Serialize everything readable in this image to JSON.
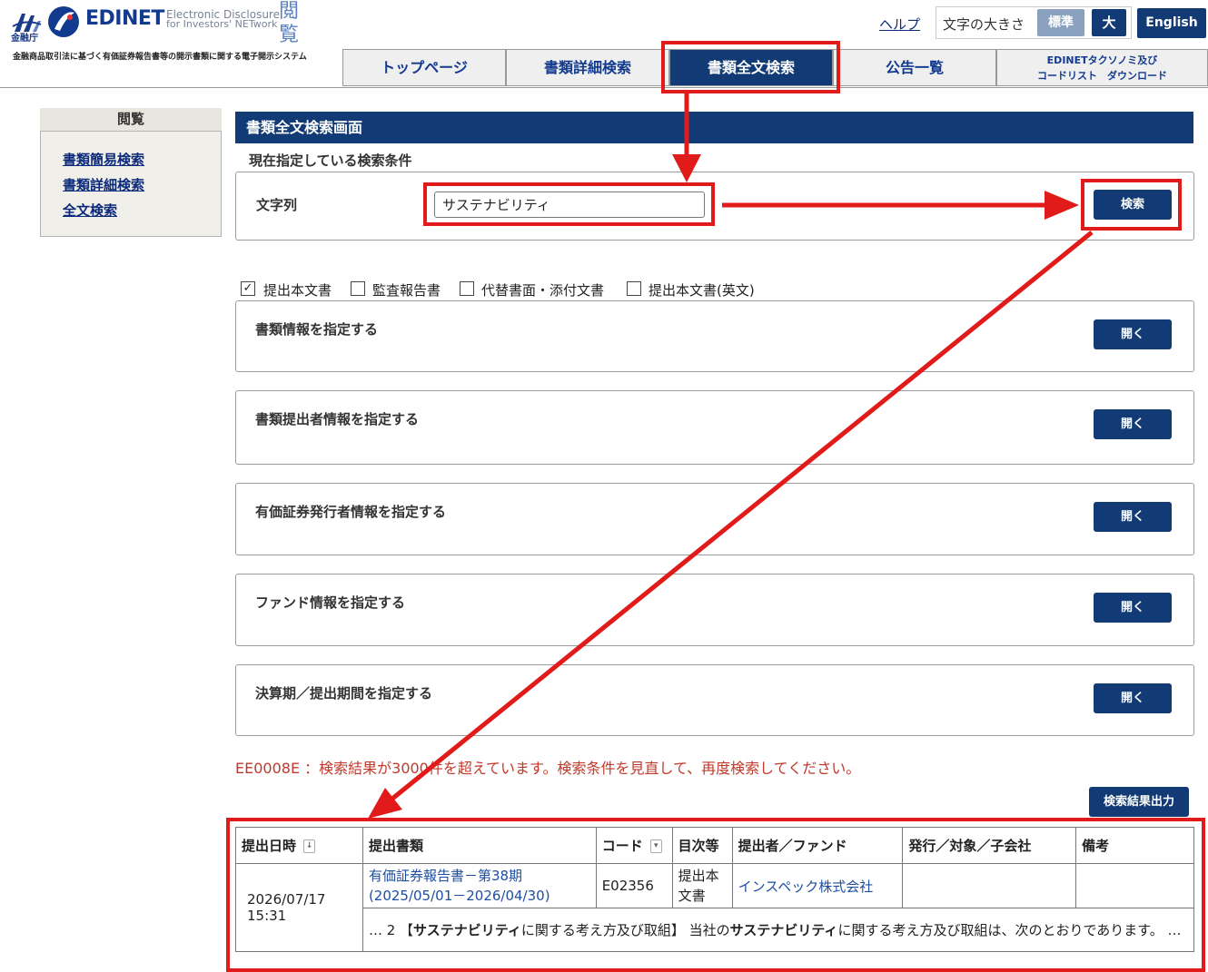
{
  "header": {
    "fsa_logo_text": "金融庁",
    "edinet_wordmark": "EDINET",
    "edinet_subtitle_line1": "Electronic Disclosure",
    "edinet_subtitle_line2": "for Investors' NETwork",
    "etsuran_line1": "閲",
    "etsuran_line2": "覧",
    "tagline": "金融商品取引法に基づく有価証券報告書等の開示書類に関する電子開示システム",
    "help_label": "ヘルプ",
    "font_size_label": "文字の大きさ",
    "font_standard_label": "標準",
    "font_large_label": "大",
    "english_label": "English"
  },
  "nav": {
    "tabs": [
      {
        "label": "トップページ",
        "active": false
      },
      {
        "label": "書類詳細検索",
        "active": false
      },
      {
        "label": "書類全文検索",
        "active": true
      },
      {
        "label": "公告一覧",
        "active": false
      },
      {
        "label_line1": "EDINETタクソノミ及び",
        "label_line2": "コードリスト　ダウンロード",
        "active": false
      }
    ]
  },
  "sidebar": {
    "title": "閲覧",
    "items": [
      {
        "label": "書類簡易検索"
      },
      {
        "label": "書類詳細検索"
      },
      {
        "label": "全文検索"
      }
    ]
  },
  "main": {
    "title": "書類全文検索画面",
    "current_conditions_label": "現在指定している検索条件",
    "keyword_label": "文字列",
    "keyword_value": "サステナビリティ",
    "search_button": "検索",
    "doc_types": [
      {
        "label": "提出本文書",
        "checked": true
      },
      {
        "label": "監査報告書",
        "checked": false
      },
      {
        "label": "代替書面・添付文書",
        "checked": false
      },
      {
        "label": "提出本文書(英文)",
        "checked": false
      }
    ],
    "sections": [
      {
        "title": "書類情報を指定する",
        "button": "開く"
      },
      {
        "title": "書類提出者情報を指定する",
        "button": "開く"
      },
      {
        "title": "有価証券発行者情報を指定する",
        "button": "開く"
      },
      {
        "title": "ファンド情報を指定する",
        "button": "開く"
      },
      {
        "title": "決算期／提出期間を指定する",
        "button": "開く"
      }
    ],
    "error_message": "EE0008E ：検索結果が3000件を超えています。検索条件を見直して、再度検索してください。",
    "export_button": "検索結果出力"
  },
  "results": {
    "columns": [
      "提出日時",
      "提出書類",
      "コード",
      "目次等",
      "提出者／ファンド",
      "発行／対象／子会社",
      "備考"
    ],
    "sort_icon_down": "↓",
    "sort_icon_menu": "▾",
    "rows": [
      {
        "datetime": "2026/07/17 15:31",
        "document": "有価証券報告書－第38期(2025/05/01－2026/04/30)",
        "code": "E02356",
        "toc": "提出本文書",
        "filer": "インスペック株式会社",
        "issuer": "",
        "remarks": "",
        "snippet_prefix": "… 2 【",
        "snippet_kw1": "サステナビリティ",
        "snippet_mid": "に関する考え方及び取組】 当社の",
        "snippet_kw2": "サステナビリティ",
        "snippet_suffix": "に関する考え方及び取組は、次のとおりであります。 …"
      }
    ]
  },
  "colors": {
    "navy": "#123a74",
    "annotation_red": "#e11a1a",
    "error_red": "#c0392b",
    "link_blue": "#0b2a7a"
  }
}
